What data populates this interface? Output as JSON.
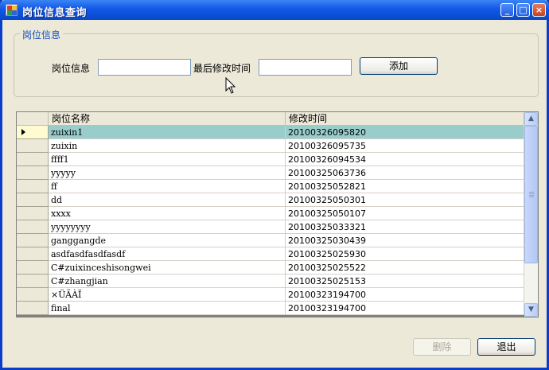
{
  "window": {
    "title": "岗位信息查询"
  },
  "titlebar_buttons": {
    "minimize": "_",
    "maximize": "□",
    "close": "×"
  },
  "group": {
    "legend": "岗位信息",
    "position_label": "岗位信息",
    "position_value": "",
    "modified_label": "最后修改时间",
    "modified_value": "",
    "add_button": "添加"
  },
  "grid": {
    "columns": [
      "岗位名称",
      "修改时间"
    ],
    "rows": [
      {
        "name": "zuixin1",
        "time": "20100326095820",
        "selected": true
      },
      {
        "name": "zuixin",
        "time": "20100326095735"
      },
      {
        "name": "ffff1",
        "time": "20100326094534"
      },
      {
        "name": "yyyyy",
        "time": "20100325063736"
      },
      {
        "name": "ff",
        "time": "20100325052821"
      },
      {
        "name": "dd",
        "time": "20100325050301"
      },
      {
        "name": "xxxx",
        "time": "20100325050107"
      },
      {
        "name": "yyyyyyyy",
        "time": "20100325033321"
      },
      {
        "name": "ganggangde",
        "time": "20100325030439"
      },
      {
        "name": "asdfasdfasdfasdf",
        "time": "20100325025930"
      },
      {
        "name": "C#zuixinceshisongwei",
        "time": "20100325025522"
      },
      {
        "name": "C#zhangjian",
        "time": "20100325025153"
      },
      {
        "name": "×ÜÃ­ÀÏ",
        "time": "20100323194700"
      },
      {
        "name": "final",
        "time": "20100323194700"
      }
    ]
  },
  "footer": {
    "delete_button": "删除",
    "exit_button": "退出"
  }
}
